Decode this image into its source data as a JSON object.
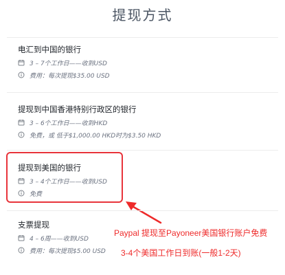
{
  "page": {
    "title": "提现方式"
  },
  "methods": [
    {
      "title": "电汇到中国的银行",
      "time": "3 – 7个工作日——收到USD",
      "fee": "费用：每次提现$35.00 USD"
    },
    {
      "title": "提现到中国香港特别行政区的银行",
      "time": "3 – 6个工作日——收到HKD",
      "fee": "免费，或 低于$1,000.00 HKD时为$3.50 HKD"
    },
    {
      "title": "提现到美国的银行",
      "time": "3 – 4个工作日——收到USD",
      "fee": "免费"
    },
    {
      "title": "支票提现",
      "time": "4 – 6周——收到USD",
      "fee": "费用：每次提现$5.00 USD"
    }
  ],
  "annotations": {
    "line1": "Paypal 提现至Payoneer美国银行账户免费",
    "line2": "3-4个美国工作日到账(一般1-2天)"
  },
  "colors": {
    "highlight": "#e8333a",
    "annotation_text": "#ee2a2a",
    "icon_gray": "#7b8189"
  },
  "icons": {
    "time": "calendar-icon",
    "fee": "info-icon"
  }
}
